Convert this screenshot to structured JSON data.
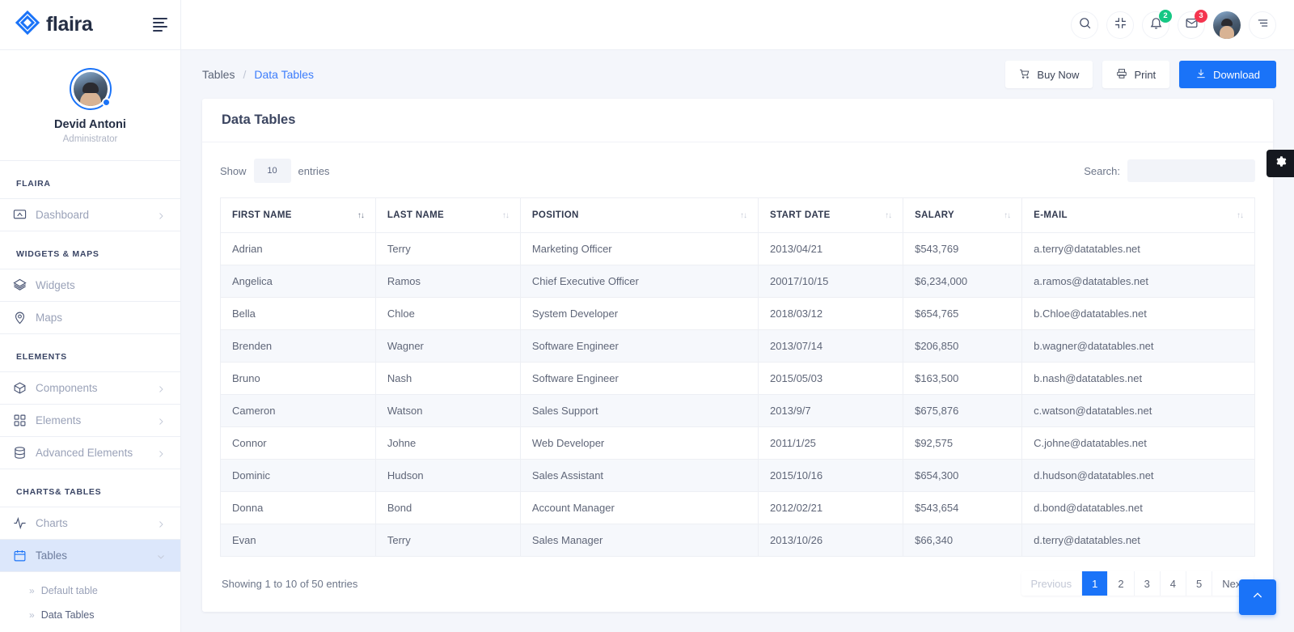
{
  "brand": {
    "name": "flaira",
    "logo_icon": "flaira-diamond-logo"
  },
  "profile": {
    "name": "Devid Antoni",
    "role": "Administrator"
  },
  "sidebar": {
    "sections": [
      {
        "title": "FLAIRA",
        "items": [
          {
            "label": "Dashboard",
            "icon": "dashboard-icon",
            "chevron": "chevron-right-icon",
            "active": false
          }
        ]
      },
      {
        "title": "WIDGETS & MAPS",
        "items": [
          {
            "label": "Widgets",
            "icon": "layers-icon",
            "chevron": "",
            "active": false
          },
          {
            "label": "Maps",
            "icon": "map-pin-icon",
            "chevron": "",
            "active": false
          }
        ]
      },
      {
        "title": "ELEMENTS",
        "items": [
          {
            "label": "Components",
            "icon": "box-icon",
            "chevron": "chevron-right-icon",
            "active": false
          },
          {
            "label": "Elements",
            "icon": "grid-icon",
            "chevron": "chevron-right-icon",
            "active": false
          },
          {
            "label": "Advanced Elements",
            "icon": "database-icon",
            "chevron": "chevron-right-icon",
            "active": false
          }
        ]
      },
      {
        "title": "CHARTS& TABLES",
        "items": [
          {
            "label": "Charts",
            "icon": "activity-icon",
            "chevron": "chevron-right-icon",
            "active": false
          },
          {
            "label": "Tables",
            "icon": "calendar-icon",
            "chevron": "chevron-down-icon",
            "active": true
          }
        ]
      }
    ],
    "sub_items": [
      {
        "label": "Default table",
        "marker": "»",
        "current": false
      },
      {
        "label": "Data Tables",
        "marker": "»",
        "current": true
      }
    ]
  },
  "topbar": {
    "icons": [
      {
        "name": "search-icon",
        "badge": "",
        "badge_color": ""
      },
      {
        "name": "compress-icon",
        "badge": "",
        "badge_color": ""
      },
      {
        "name": "bell-icon",
        "badge": "2",
        "badge_color": "#16c784"
      },
      {
        "name": "envelope-icon",
        "badge": "3",
        "badge_color": "#f4354f"
      }
    ],
    "avatar": "user-avatar",
    "menu_icon": "menu-align-icon"
  },
  "breadcrumb": {
    "parent": "Tables",
    "separator": "/",
    "current": "Data Tables"
  },
  "header_actions": [
    {
      "label": "Buy Now",
      "icon": "cart-icon",
      "primary": false
    },
    {
      "label": "Print",
      "icon": "printer-icon",
      "primary": false
    },
    {
      "label": "Download",
      "icon": "download-icon",
      "primary": true
    }
  ],
  "card": {
    "title": "Data Tables",
    "show_label": "Show",
    "entries_label": "entries",
    "page_length": "10",
    "search_label": "Search:",
    "search_value": "",
    "search_placeholder": ""
  },
  "table": {
    "columns": [
      {
        "label": "FIRST NAME",
        "sort": "↑↓",
        "sort_active": true
      },
      {
        "label": "LAST NAME",
        "sort": "↑↓",
        "sort_active": false
      },
      {
        "label": "POSITION",
        "sort": "↑↓",
        "sort_active": false
      },
      {
        "label": "START DATE",
        "sort": "↑↓",
        "sort_active": false
      },
      {
        "label": "SALARY",
        "sort": "↑↓",
        "sort_active": false
      },
      {
        "label": "E-MAIL",
        "sort": "↑↓",
        "sort_active": false
      }
    ],
    "rows": [
      [
        "Adrian",
        "Terry",
        "Marketing Officer",
        "2013/04/21",
        "$543,769",
        "a.terry@datatables.net"
      ],
      [
        "Angelica",
        "Ramos",
        "Chief Executive Officer",
        "20017/10/15",
        "$6,234,000",
        "a.ramos@datatables.net"
      ],
      [
        "Bella",
        "Chloe",
        "System Developer",
        "2018/03/12",
        "$654,765",
        "b.Chloe@datatables.net"
      ],
      [
        "Brenden",
        "Wagner",
        "Software Engineer",
        "2013/07/14",
        "$206,850",
        "b.wagner@datatables.net"
      ],
      [
        "Bruno",
        "Nash",
        "Software Engineer",
        "2015/05/03",
        "$163,500",
        "b.nash@datatables.net"
      ],
      [
        "Cameron",
        "Watson",
        "Sales Support",
        "2013/9/7",
        "$675,876",
        "c.watson@datatables.net"
      ],
      [
        "Connor",
        "Johne",
        "Web Developer",
        "2011/1/25",
        "$92,575",
        "C.johne@datatables.net"
      ],
      [
        "Dominic",
        "Hudson",
        "Sales Assistant",
        "2015/10/16",
        "$654,300",
        "d.hudson@datatables.net"
      ],
      [
        "Donna",
        "Bond",
        "Account Manager",
        "2012/02/21",
        "$543,654",
        "d.bond@datatables.net"
      ],
      [
        "Evan",
        "Terry",
        "Sales Manager",
        "2013/10/26",
        "$66,340",
        "d.terry@datatables.net"
      ]
    ]
  },
  "footer": {
    "info": "Showing 1 to 10 of 50 entries",
    "pagination": [
      {
        "label": "Previous",
        "state": "disabled"
      },
      {
        "label": "1",
        "state": "active"
      },
      {
        "label": "2",
        "state": ""
      },
      {
        "label": "3",
        "state": ""
      },
      {
        "label": "4",
        "state": ""
      },
      {
        "label": "5",
        "state": ""
      },
      {
        "label": "Next",
        "state": ""
      }
    ]
  },
  "floating": {
    "settings_icon": "gear-icon",
    "to_top_icon": "chevron-up-icon"
  },
  "colors": {
    "accent": "#1a73f8",
    "link": "#3d7dfb",
    "badge_green": "#16c784",
    "badge_red": "#f4354f"
  }
}
